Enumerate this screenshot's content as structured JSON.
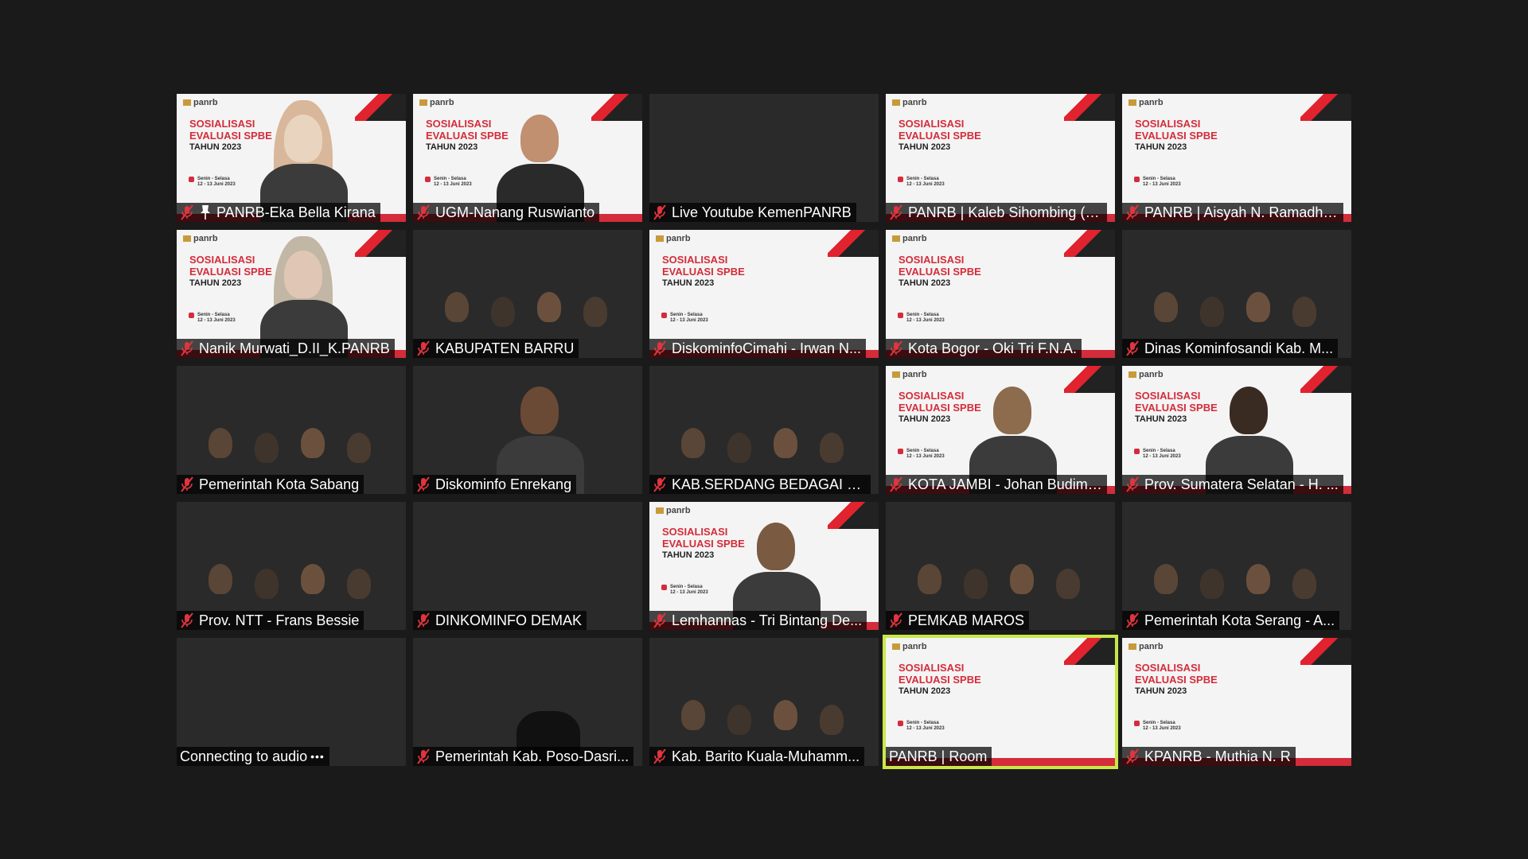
{
  "slide": {
    "logo": "panrb",
    "title_line1": "SOSIALISASI",
    "title_line2": "EVALUASI SPBE",
    "title_line3": "TAHUN 2023",
    "date_line1": "Senin - Selasa",
    "date_line2": "12 - 13 Juni 2023"
  },
  "participants": [
    {
      "name": "PANRB-Eka Bella Kirana"
    },
    {
      "name": "UGM-Nanang Ruswianto"
    },
    {
      "name": "Live Youtube KemenPANRB"
    },
    {
      "name": "PANRB | Kaleb Sihombing (S..."
    },
    {
      "name": "PANRB | Aisyah N. Ramadha..."
    },
    {
      "name": "Nanik Murwati_D.II_K.PANRB"
    },
    {
      "name": "KABUPATEN BARRU"
    },
    {
      "name": "DiskominfoCimahi - Irwan N..."
    },
    {
      "name": "Kota Bogor - Oki Tri F.N.A."
    },
    {
      "name": "Dinas Kominfosandi Kab. M..."
    },
    {
      "name": "Pemerintah Kota Sabang"
    },
    {
      "name": "Diskominfo Enrekang"
    },
    {
      "name": "KAB.SERDANG BEDAGAI - IN..."
    },
    {
      "name": "KOTA JAMBI - Johan Budiman"
    },
    {
      "name": "Prov. Sumatera Selatan - H. ..."
    },
    {
      "name": "Prov. NTT - Frans Bessie"
    },
    {
      "name": "DINKOMINFO DEMAK"
    },
    {
      "name": "Lemhannas - Tri Bintang De..."
    },
    {
      "name": "PEMKAB MAROS"
    },
    {
      "name": "Pemerintah Kota Serang - A..."
    },
    {
      "name": "Connecting to audio"
    },
    {
      "name": "Pemerintah Kab. Poso-Dasri..."
    },
    {
      "name": "Kab. Barito Kuala-Muhamm..."
    },
    {
      "name": "PANRB | Room"
    },
    {
      "name": "KPANRB - Muthia N. R"
    }
  ]
}
